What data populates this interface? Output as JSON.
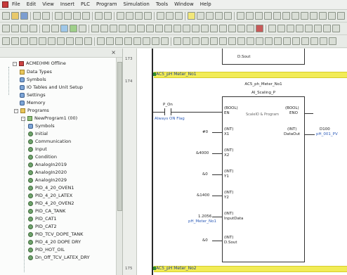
{
  "menu": {
    "items": [
      "File",
      "Edit",
      "View",
      "Insert",
      "PLC",
      "Program",
      "Simulation",
      "Tools",
      "Window",
      "Help"
    ]
  },
  "tree": {
    "controller": "ACME(HMI Offline",
    "items": [
      {
        "label": "Data Types",
        "icon": "folder"
      },
      {
        "label": "Symbols",
        "icon": "db"
      },
      {
        "label": "IO Tables and Unit Setup",
        "icon": "db"
      },
      {
        "label": "Settings",
        "icon": "db"
      },
      {
        "label": "Memory",
        "icon": "db"
      },
      {
        "label": "Programs",
        "icon": "folder"
      },
      {
        "label": "NewProgram1 (00)",
        "icon": "prog"
      },
      {
        "label": "Symbols",
        "icon": "db"
      },
      {
        "label": "Initial",
        "icon": "sub"
      },
      {
        "label": "Communication",
        "icon": "sub"
      },
      {
        "label": "Input",
        "icon": "sub"
      },
      {
        "label": "Condition",
        "icon": "sub"
      },
      {
        "label": "AnalogIn2019",
        "icon": "sub"
      },
      {
        "label": "AnalogIn2020",
        "icon": "sub"
      },
      {
        "label": "AnalogIn2029",
        "icon": "sub"
      },
      {
        "label": "PID_4_20_OVEN1",
        "icon": "sub"
      },
      {
        "label": "PID_4_20_LATEX",
        "icon": "sub"
      },
      {
        "label": "PID_4_20_OVEN2",
        "icon": "sub"
      },
      {
        "label": "PID_CA_TANK",
        "icon": "sub"
      },
      {
        "label": "PID_CAT1",
        "icon": "sub"
      },
      {
        "label": "PID_CAT2",
        "icon": "sub"
      },
      {
        "label": "PID_TCV_DOPE_TANK",
        "icon": "sub"
      },
      {
        "label": "PID_4_20 DOPE DRY",
        "icon": "sub"
      },
      {
        "label": "PID_HOT_OIL",
        "icon": "sub"
      },
      {
        "label": "Dn_Off_TCV_LATEX_DRY",
        "icon": "sub"
      }
    ]
  },
  "ladder": {
    "rung_prev_num": "173",
    "rung_num": "174",
    "rung_next_num": "175",
    "top_pin": "D.Sout",
    "rung_title": "AC5_pH Meter_No1",
    "fb_instance": "AC5_ph_Meter_No1",
    "fb_name": "AI_Scaling_P",
    "contact_label": "P_On",
    "contact_comment": "Always ON Flag",
    "inputs": [
      {
        "value": "EN",
        "type": "(BOOL)",
        "pin": "EN"
      },
      {
        "value": "#0",
        "type": "(INT)",
        "pin": "X1"
      },
      {
        "value": "&4000",
        "type": "(INT)",
        "pin": "X2"
      },
      {
        "value": "&0",
        "type": "(INT)",
        "pin": "Y1"
      },
      {
        "value": "&1400",
        "type": "(INT)",
        "pin": "Y2"
      },
      {
        "value": "1.2056",
        "type": "(INT)",
        "pin": "InputData",
        "comment": "pH_Meter_No1"
      },
      {
        "value": "&0",
        "type": "(INT)",
        "pin": "D.Sout"
      }
    ],
    "outputs": [
      {
        "type": "(BOOL)",
        "pin": "ENO"
      },
      {
        "type": "(INT)",
        "pin": "DataOut",
        "value": "D100",
        "comment": "pH_001_PV"
      }
    ],
    "fb_note": "ScaleIO & Program",
    "next_rung_title": "AC5_pH Meter_No2"
  }
}
